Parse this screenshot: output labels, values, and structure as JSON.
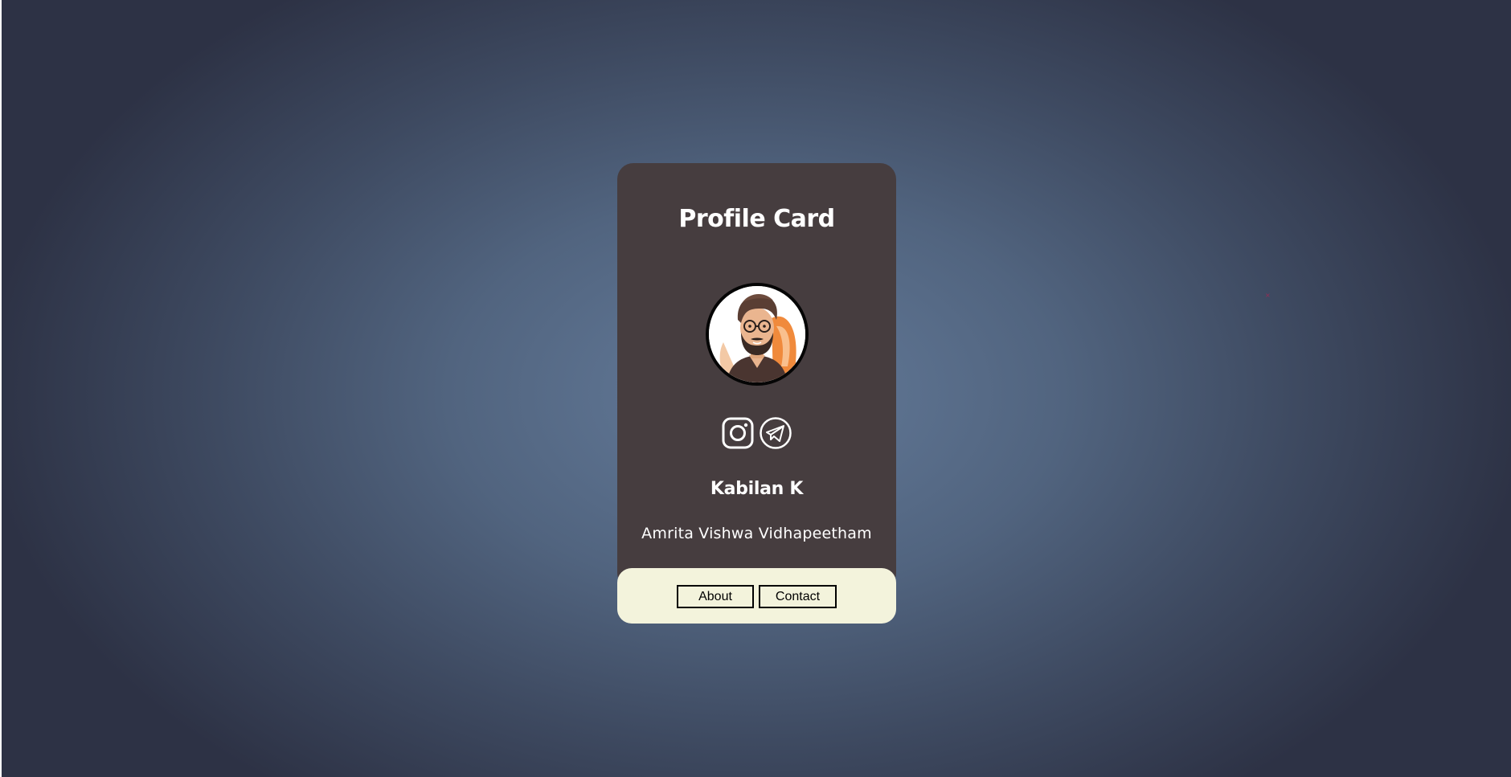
{
  "card": {
    "title": "Profile Card",
    "avatar_alt": "cartoon avatar of a man with glasses and beard",
    "social_icons": [
      "instagram-icon",
      "telegram-icon"
    ],
    "name": "Kabilan K",
    "organization": "Amrita Vishwa Vidhapeetham",
    "buttons": {
      "about_label": "About",
      "contact_label": "Contact"
    }
  },
  "colors": {
    "card_background": "#463d3f",
    "card_footer_background": "#f3f3dc",
    "page_background_center": "#647b9a",
    "page_background_edge": "#2d3245",
    "text_primary": "#ffffff"
  }
}
